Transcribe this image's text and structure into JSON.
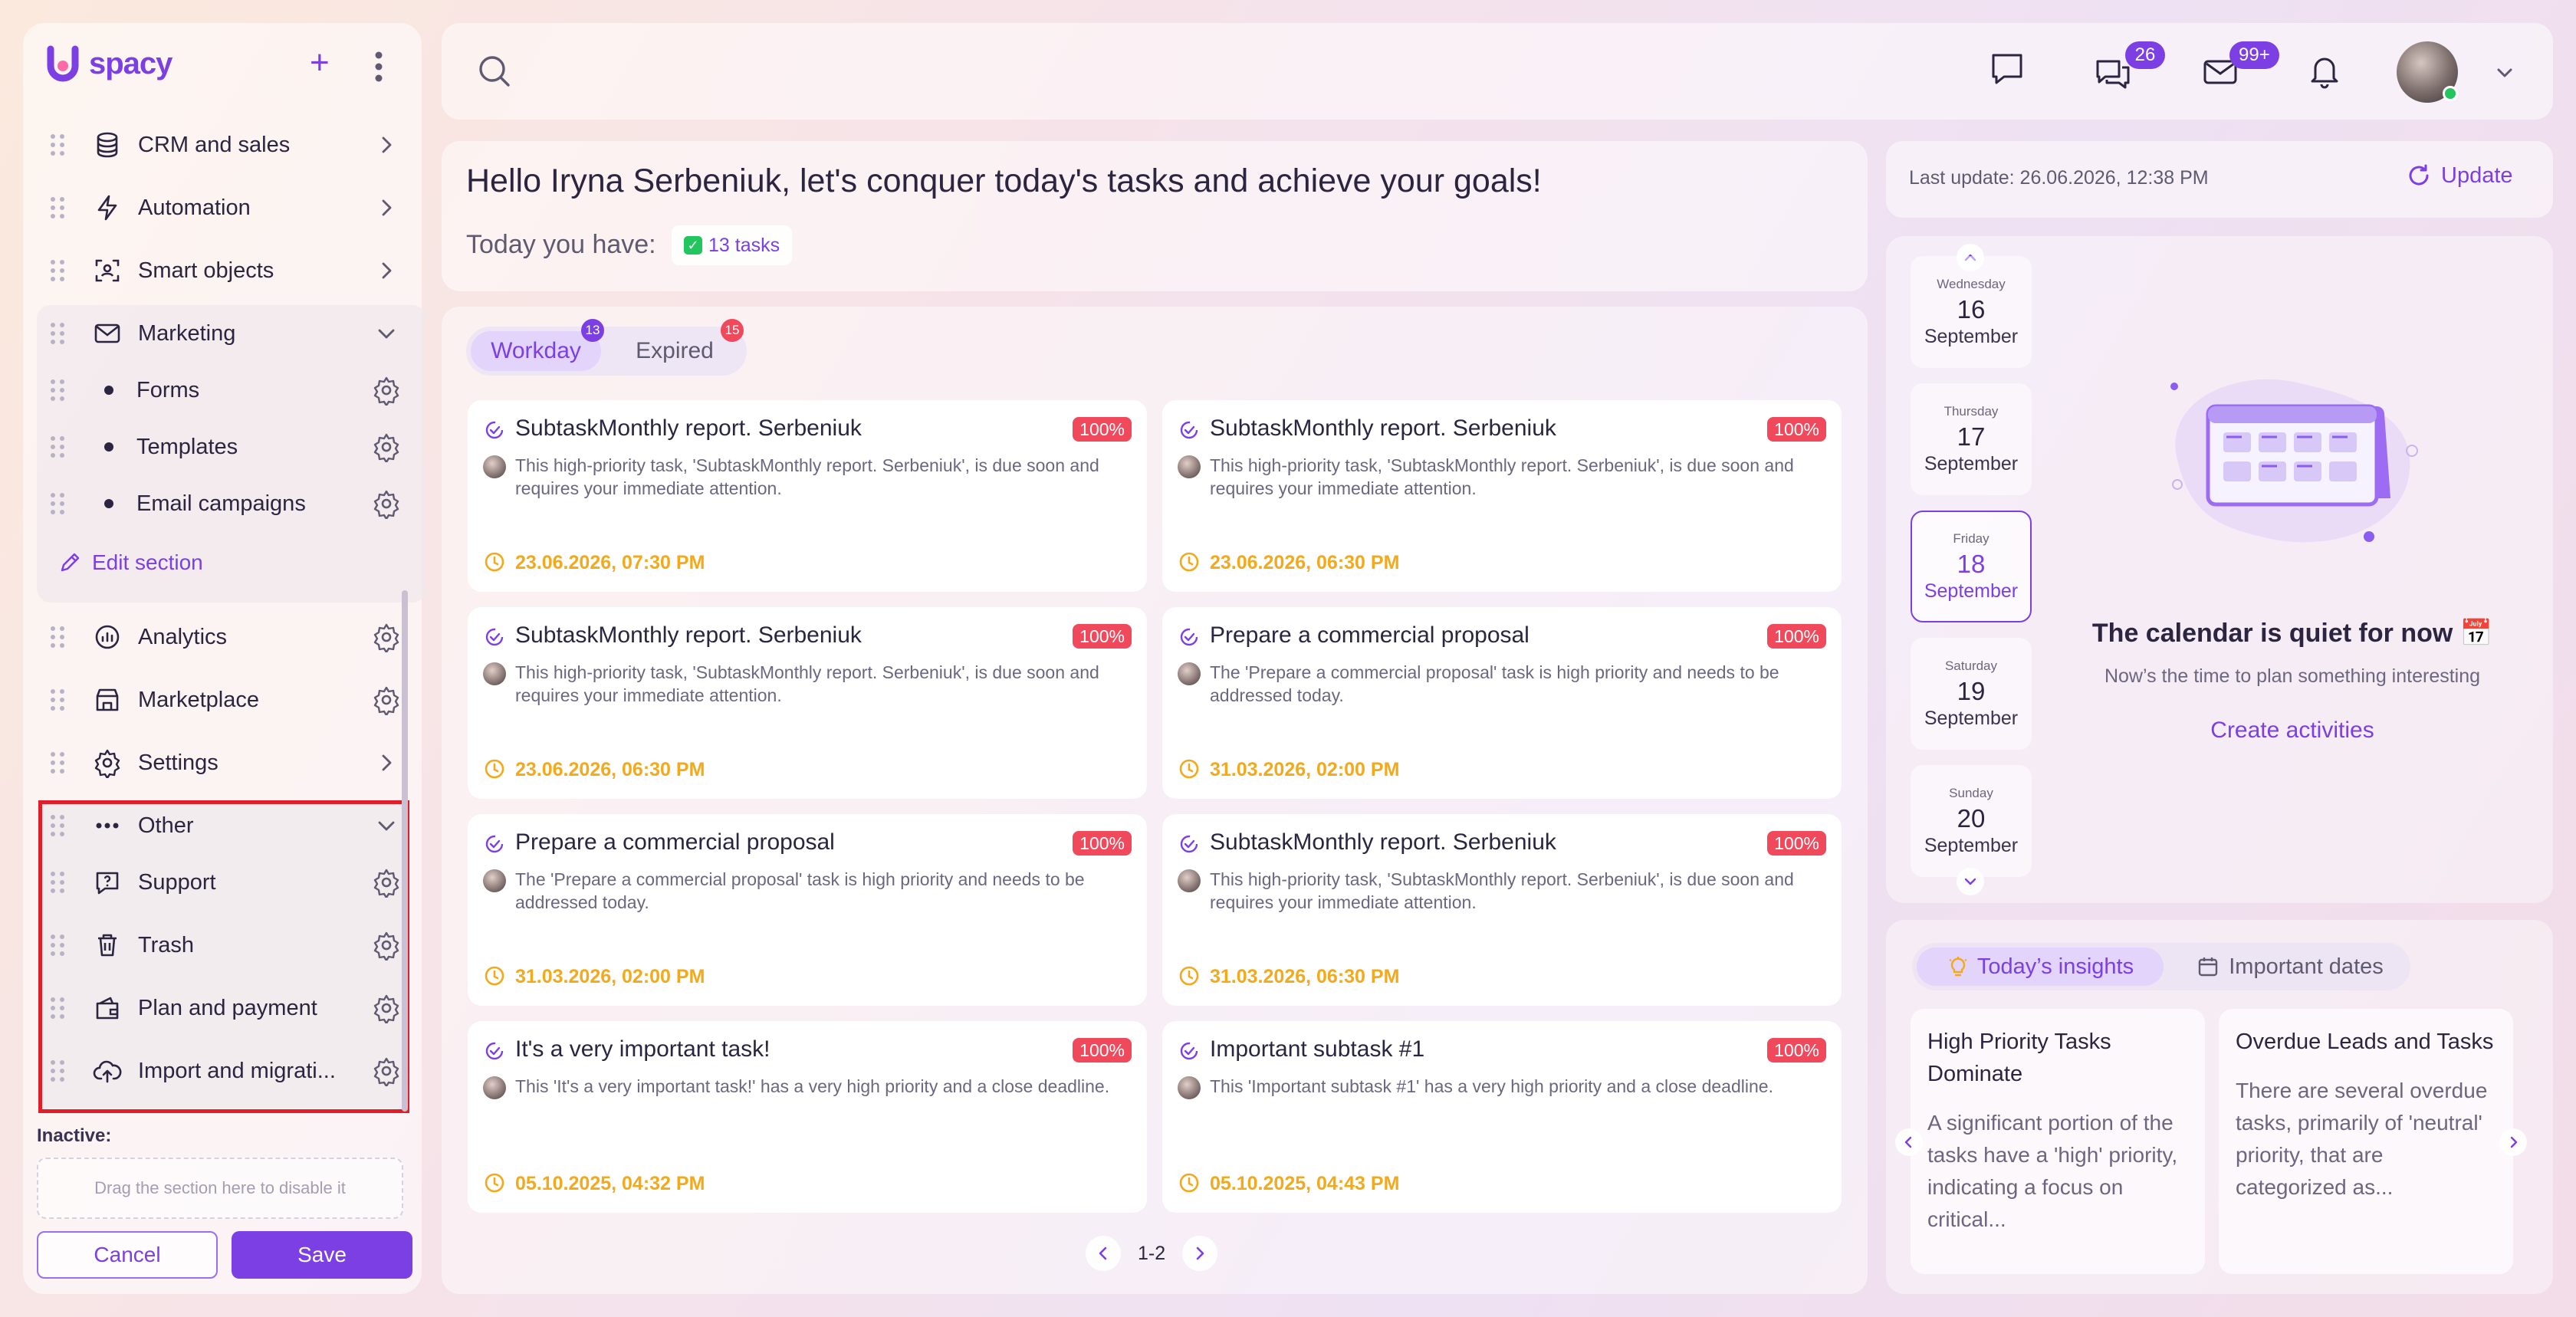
{
  "brand": {
    "name": "spacy",
    "accent": "#7b3fe4"
  },
  "sidebar": {
    "items": [
      {
        "label": "CRM and sales",
        "icon": "database-icon"
      },
      {
        "label": "Automation",
        "icon": "lightning-icon"
      },
      {
        "label": "Smart objects",
        "icon": "scan-icon"
      },
      {
        "label": "Marketing",
        "icon": "mail-icon"
      },
      {
        "label": "Forms"
      },
      {
        "label": "Templates"
      },
      {
        "label": "Email campaigns"
      },
      {
        "label": "Analytics",
        "icon": "analytics-icon"
      },
      {
        "label": "Marketplace",
        "icon": "store-icon"
      },
      {
        "label": "Settings",
        "icon": "gear-icon"
      },
      {
        "label": "Other",
        "icon": "more-icon"
      },
      {
        "label": "Support",
        "icon": "support-icon"
      },
      {
        "label": "Trash",
        "icon": "trash-icon"
      },
      {
        "label": "Plan and payment",
        "icon": "wallet-icon"
      },
      {
        "label": "Import and migrati...",
        "icon": "upload-icon"
      }
    ],
    "edit_section": "Edit section",
    "inactive_label": "Inactive:",
    "drop_hint": "Drag the section here to disable it",
    "cancel": "Cancel",
    "save": "Save"
  },
  "topbar": {
    "chat_badge": "26",
    "mail_badge": "99+"
  },
  "greeting": {
    "title": "Hello Iryna Serbeniuk, let's conquer today's tasks and achieve your goals!",
    "today_label": "Today you have:",
    "tasks_chip": "13 tasks"
  },
  "tasks": {
    "tabs": [
      {
        "label": "Workday",
        "badge": "13",
        "badge_color": "#7b3fe4"
      },
      {
        "label": "Expired",
        "badge": "15",
        "badge_color": "#f0495c"
      }
    ],
    "cards": [
      {
        "title": "SubtaskMonthly report. Serbeniuk",
        "pct": "100%",
        "desc": "This high-priority task, 'SubtaskMonthly report. Serbeniuk', is due soon and requires your immediate attention.",
        "date": "23.06.2026, 07:30 PM"
      },
      {
        "title": "SubtaskMonthly report. Serbeniuk",
        "pct": "100%",
        "desc": "This high-priority task, 'SubtaskMonthly report. Serbeniuk', is due soon and requires your immediate attention.",
        "date": "23.06.2026, 06:30 PM"
      },
      {
        "title": "SubtaskMonthly report. Serbeniuk",
        "pct": "100%",
        "desc": "This high-priority task, 'SubtaskMonthly report. Serbeniuk', is due soon and requires your immediate attention.",
        "date": "23.06.2026, 06:30 PM"
      },
      {
        "title": "Prepare a commercial proposal",
        "pct": "100%",
        "desc": "The 'Prepare a commercial proposal' task is high priority and needs to be addressed today.",
        "date": "31.03.2026, 02:00 PM"
      },
      {
        "title": "Prepare a commercial proposal",
        "pct": "100%",
        "desc": "The 'Prepare a commercial proposal' task is high priority and needs to be addressed today.",
        "date": "31.03.2026, 02:00 PM"
      },
      {
        "title": "SubtaskMonthly report. Serbeniuk",
        "pct": "100%",
        "desc": "This high-priority task, 'SubtaskMonthly report. Serbeniuk', is due soon and requires your immediate attention.",
        "date": "31.03.2026, 06:30 PM"
      },
      {
        "title": "It's a very important task!",
        "pct": "100%",
        "desc": "This 'It's a very important task!' has a very high priority and a close deadline.",
        "date": "05.10.2025, 04:32 PM"
      },
      {
        "title": "Important subtask #1",
        "pct": "100%",
        "desc": "This 'Important subtask #1' has a very high priority and a close deadline.",
        "date": "05.10.2025, 04:43 PM"
      }
    ],
    "pager": "1-2"
  },
  "update": {
    "last_update": "Last update: 26.06.2026, 12:38 PM",
    "button": "Update"
  },
  "calendar": {
    "days": [
      {
        "name": "Wednesday",
        "num": "16",
        "month": "September"
      },
      {
        "name": "Thursday",
        "num": "17",
        "month": "September"
      },
      {
        "name": "Friday",
        "num": "18",
        "month": "September",
        "selected": true
      },
      {
        "name": "Saturday",
        "num": "19",
        "month": "September"
      },
      {
        "name": "Sunday",
        "num": "20",
        "month": "September"
      }
    ],
    "empty_title": "The calendar is quiet for now 📅",
    "empty_sub": "Now’s the time to plan something interesting",
    "create": "Create activities"
  },
  "insights": {
    "tabs": [
      {
        "label": "Today’s insights",
        "icon": "lightbulb-icon"
      },
      {
        "label": "Important dates",
        "icon": "calendar-icon"
      }
    ],
    "cards": [
      {
        "title": "High Priority Tasks Dominate",
        "body": "A significant portion of the tasks have a 'high' priority, indicating a focus on critical..."
      },
      {
        "title": "Overdue Leads and Tasks",
        "body": "There are several overdue tasks, primarily of 'neutral' priority, that are categorized as..."
      }
    ]
  }
}
